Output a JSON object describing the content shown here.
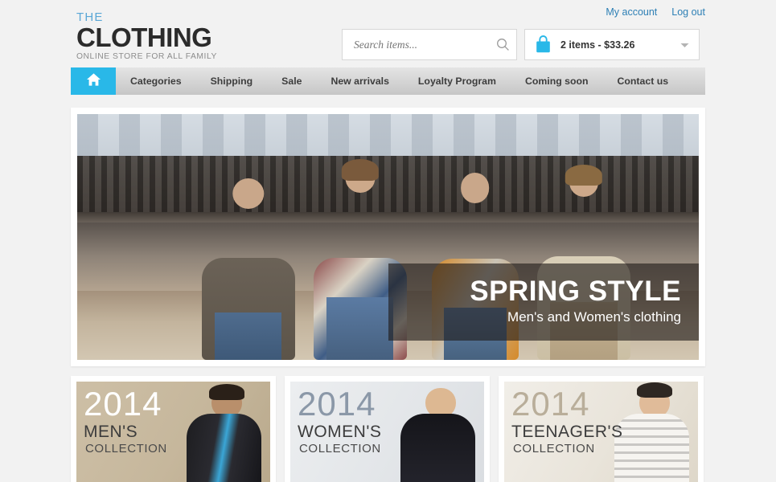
{
  "header": {
    "top_links": [
      {
        "label": "My account",
        "name": "my-account-link"
      },
      {
        "label": "Log out",
        "name": "log-out-link"
      }
    ],
    "logo": {
      "pretitle": "THE",
      "title": "CLOTHING",
      "tagline": "ONLINE STORE FOR ALL FAMILY",
      "pretitle_color": "#5aa7d6",
      "title_color": "#2b2b2b",
      "tagline_color": "#8c8c8c"
    },
    "search": {
      "placeholder": "Search items...",
      "value": "",
      "icon": "search-icon"
    },
    "cart": {
      "icon": "shopping-bag-icon",
      "summary": "2 items - $33.26",
      "items_count": "2",
      "total": "$33.26",
      "caret": "chevron-down-icon",
      "accent_color": "#29b8e8"
    }
  },
  "nav": {
    "home_icon": "home-icon",
    "home_active_color": "#29b8e8",
    "items": [
      {
        "label": "Categories"
      },
      {
        "label": "Shipping"
      },
      {
        "label": "Sale"
      },
      {
        "label": "New arrivals"
      },
      {
        "label": "Loyalty Program"
      },
      {
        "label": "Coming soon"
      },
      {
        "label": "Contact us"
      }
    ]
  },
  "hero": {
    "title": "SPRING STYLE",
    "subtitle": "Men's and Women's clothing",
    "overlay_color": "#1e1a18"
  },
  "collections": [
    {
      "year": "2014",
      "category": "MEN'S",
      "collection": "COLLECTION",
      "year_color": "#ffffff"
    },
    {
      "year": "2014",
      "category": "WOMEN'S",
      "collection": "COLLECTION",
      "year_color": "#8b98a8"
    },
    {
      "year": "2014",
      "category": "TEENAGER'S",
      "collection": "COLLECTION",
      "year_color": "#b9ae9a"
    }
  ]
}
